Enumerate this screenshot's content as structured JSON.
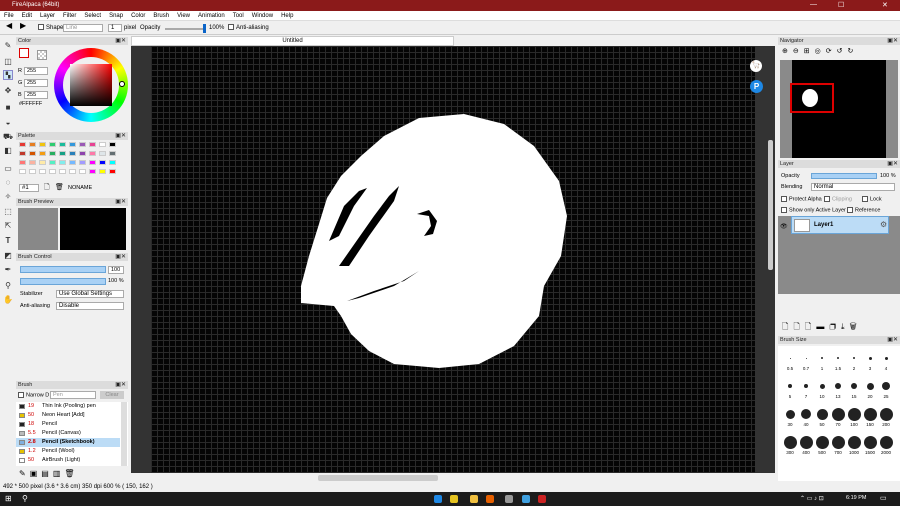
{
  "window": {
    "title": "FireAlpaca (64bit)",
    "min": "—",
    "max": "☐",
    "close": "✕"
  },
  "menu": [
    "File",
    "Edit",
    "Layer",
    "Filter",
    "Select",
    "Snap",
    "Color",
    "Brush",
    "View",
    "Animation",
    "Tool",
    "Window",
    "Help"
  ],
  "tool_options": {
    "shape_label": "Shape",
    "shape_value": "Line",
    "size_value": "1",
    "size_unit": "pixel",
    "opacity_label": "Opacity",
    "opacity_value": "100%",
    "antialias_label": "Anti-aliasing"
  },
  "document": {
    "tab_title": "Untitled"
  },
  "color_panel": {
    "title": "Color",
    "r_label": "R",
    "r": "255",
    "g_label": "G",
    "g": "255",
    "b_label": "B",
    "b": "255",
    "hex": "#FFFFFF"
  },
  "palette_panel": {
    "title": "Palette",
    "index": "#1",
    "name": "NONAME"
  },
  "brush_preview": {
    "title": "Brush Preview"
  },
  "brush_control": {
    "title": "Brush Control",
    "size": "100",
    "opacity": "100 %",
    "stabilizer_label": "Stabilizer",
    "stabilizer": "Use Global Settings",
    "antialias_label": "Anti-aliasing",
    "antialias": "Disable"
  },
  "brush_panel": {
    "title": "Brush",
    "filter_label": "Narrow D",
    "filter_placeholder": "Pen",
    "clear": "Clear",
    "items": [
      {
        "size": "19",
        "name": "Thin Ink (Pooling) pen",
        "color": "#222"
      },
      {
        "size": "50",
        "name": "Neon Heart [Add]",
        "color": "#e6c200"
      },
      {
        "size": "18",
        "name": "Pencil",
        "color": "#222"
      },
      {
        "size": "5.5",
        "name": "Pencil (Canvas)",
        "color": "#bbb"
      },
      {
        "size": "2.8",
        "name": "Pencil (Sketchbook)",
        "color": "#7fb0e0"
      },
      {
        "size": "1.2",
        "name": "Pencil (Wool)",
        "color": "#e6c200"
      },
      {
        "size": "50",
        "name": "AirBrush (Light)",
        "color": "#fff"
      }
    ]
  },
  "navigator": {
    "title": "Navigator"
  },
  "layer_panel": {
    "title": "Layer",
    "opacity_label": "Opacity",
    "opacity": "100 %",
    "blending_label": "Blending",
    "blending": "Normal",
    "protect_alpha": "Protect Alpha",
    "clipping": "Clipping",
    "lock": "Lock",
    "show_active": "Show only Active Layer",
    "reference": "Reference",
    "layer_name": "Layer1"
  },
  "brush_size_panel": {
    "title": "Brush Size",
    "sizes": [
      "0.5",
      "0.7",
      "1",
      "1.5",
      "2",
      "3",
      "4",
      "5",
      "7",
      "10",
      "13",
      "15",
      "20",
      "25",
      "30",
      "40",
      "50",
      "70",
      "100",
      "150",
      "200",
      "300",
      "400",
      "500",
      "700",
      "1000",
      "1500",
      "2000"
    ]
  },
  "status": {
    "text": "492 * 500 pixel   (3.6 * 3.6 cm)   350 dpi   600 %   ( 150, 162 )"
  },
  "taskbar": {
    "time": "6:19 PM"
  }
}
